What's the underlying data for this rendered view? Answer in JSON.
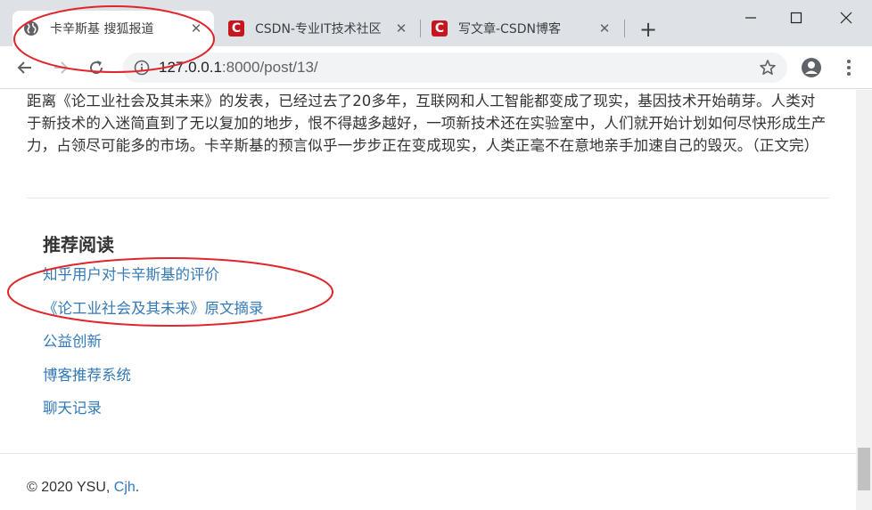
{
  "browser": {
    "tabs": [
      {
        "title": "卡辛斯基 搜狐报道",
        "active": true,
        "favicon": "globe-icon"
      },
      {
        "title": "CSDN-专业IT技术社区",
        "active": false,
        "favicon": "csdn-icon"
      },
      {
        "title": "写文章-CSDN博客",
        "active": false,
        "favicon": "csdn-icon"
      }
    ],
    "csdn_logo": "C",
    "new_tab_symbol": "+",
    "close_symbol": "✕",
    "url_host": "127.0.0.1",
    "url_rest": ":8000/post/13/"
  },
  "article": {
    "text": "距离《论工业社会及其未来》的发表，已经过去了20多年，互联网和人工智能都变成了现实，基因技术开始萌芽。人类对于新技术的入迷简直到了无以复加的地步，恨不得越多越好，一项新技术还在实验室中，人们就开始计划如何尽快形成生产力，占领尽可能多的市场。卡辛斯基的预言似乎一步步正在变成现实，人类正毫不在意地亲手加速自己的毁灭。（正文完）"
  },
  "recommend": {
    "title": "推荐阅读",
    "items": [
      "知乎用户对卡辛斯基的评价",
      "《论工业社会及其未来》原文摘录",
      "公益创新",
      "博客推荐系统",
      "聊天记录"
    ]
  },
  "footer": {
    "copyright": "© 2020 YSU, ",
    "author": "Cjh",
    "period": "."
  },
  "colors": {
    "link": "#337ab7",
    "annotation": "#e0252b",
    "csdn_red": "#c4161c"
  }
}
